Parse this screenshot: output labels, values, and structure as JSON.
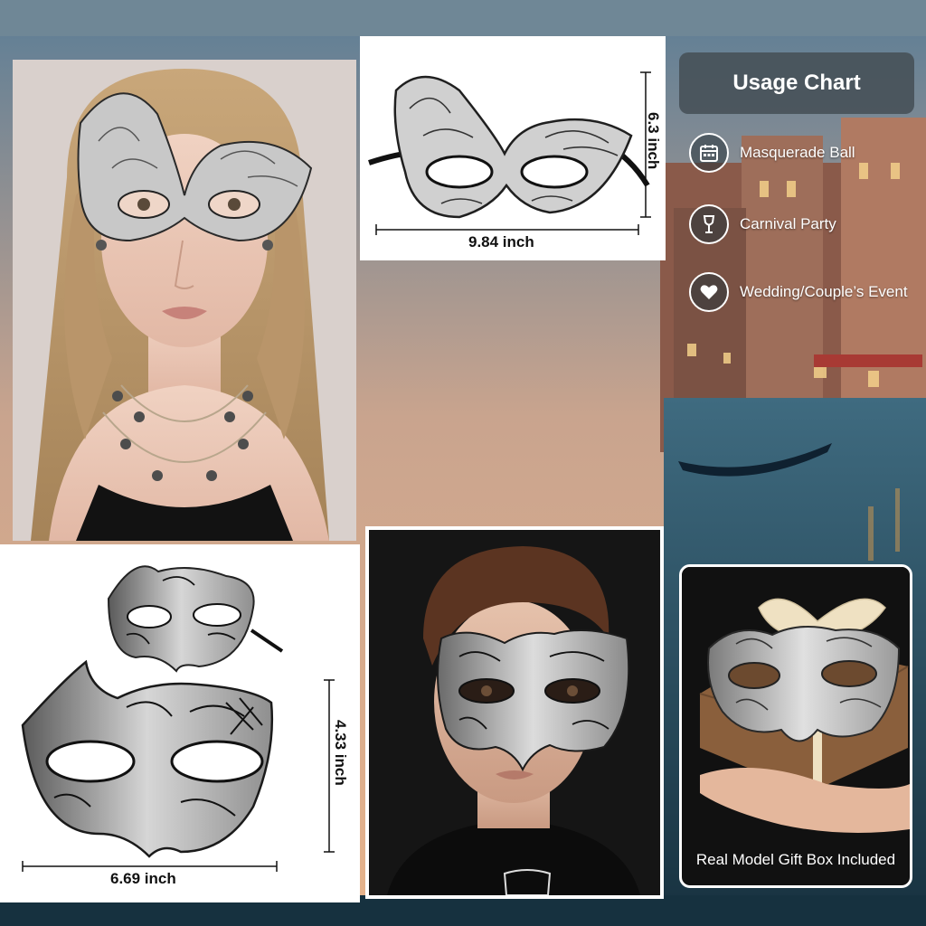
{
  "usage": {
    "title": "Usage Chart",
    "items": [
      {
        "label": "Masquerade Ball",
        "icon": "calendar-icon"
      },
      {
        "label": "Carnival Party",
        "icon": "wine-glass-icon"
      },
      {
        "label": "Wedding/Couple’s Event",
        "icon": "heart-icon"
      }
    ]
  },
  "lace_mask": {
    "height_label": "6.3 inch",
    "width_label": "9.84 inch"
  },
  "pair_masks": {
    "height_label": "4.33 inch",
    "width_label": "6.69 inch"
  },
  "gift": {
    "caption": "Real Model Gift Box Included"
  },
  "colors": {
    "mask_silver": "#b9b9b9",
    "mask_black": "#1a1a1a",
    "chart_box": "#465056",
    "background_water": "#1d3a4a"
  }
}
